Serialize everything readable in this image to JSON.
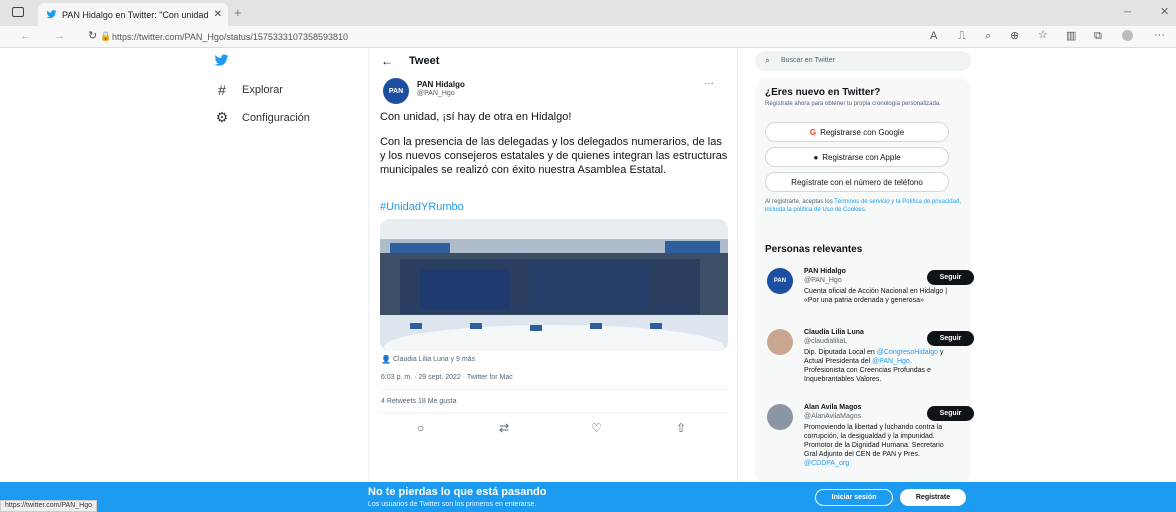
{
  "browser": {
    "tab_title": "PAN Hidalgo en Twitter: \"Con unidad, ¡sí hay de otra...\"",
    "url": "https://twitter.com/PAN_Hgo/status/1575333107358593810",
    "icons": [
      "tab-actions-icon",
      "twitter-bird-icon",
      "close-icon",
      "new-tab-icon",
      "back-icon",
      "forward-icon",
      "refresh-icon",
      "lock-icon",
      "read-aloud-icon",
      "immersive-reader-icon",
      "search-page-icon",
      "zoom-icon",
      "favorite-icon",
      "split-screen-icon",
      "collections-icon",
      "profile-icon",
      "more-icon",
      "minimize-icon",
      "close-window-icon"
    ]
  },
  "nav": {
    "items": [
      {
        "icon": "hashtag-icon",
        "label": "Explorar"
      },
      {
        "icon": "settings-icon",
        "label": "Configuración"
      }
    ]
  },
  "tweet_header": {
    "back": "←",
    "title": "Tweet"
  },
  "tweet": {
    "author_name": "PAN Hidalgo",
    "author_handle": "@PAN_Hgo",
    "avatar_text": "PAN",
    "more": "···",
    "text1": "Con unidad, ¡sí hay de otra en Hidalgo!",
    "text2": "Con la presencia de las delegadas y los delegados numerarios, de las y los nuevos consejeros estatales y de quienes integran las estructuras municipales se realizó con éxito nuestra Asamblea Estatal.",
    "hashtag": "#UnidadYRumbo",
    "photo_tag": "Claudia Lilia Luna y 9 más",
    "timestamp": "6:03 p. m. · 29 sept. 2022 · Twitter for Mac",
    "stats": "4 Retweets   18 Me gusta",
    "colors": {
      "accent": "#1d9bf0"
    }
  },
  "sidebar": {
    "search_placeholder": "Buscar en Twitter",
    "new_title": "¿Eres nuevo en Twitter?",
    "new_sub": "Regístrate ahora para obtener tu propia cronología personalizada.",
    "google_label": "Registrarse con Google",
    "apple_label": "Registrarse con Apple",
    "phone_label": "Regístrate con el número de teléfono",
    "terms_prefix": "Al registrarte, aceptas los ",
    "terms_link": "Términos de servicio y la Política de privacidad, incluida la política de Uso de Cookies.",
    "relevant_title": "Personas relevantes",
    "people": [
      {
        "name": "PAN Hidalgo",
        "handle": "@PAN_Hgo",
        "bio": "Cuenta oficial de Acción Nacional en Hidalgo | «Por una patria ordenada y generosa»",
        "follow": "Seguir"
      },
      {
        "name": "Claudia Lilia Luna",
        "handle": "@claudialiliaL",
        "bio_prefix": "Dip. Diputada Local en ",
        "bio_link1": "@CongresoHidalgo",
        "bio_mid": " y Actual Presidenta del ",
        "bio_link2": "@PAN_Hgo",
        "bio_suffix": ". Profesionista con Creencias Profundas e Inquebrantables Valores.",
        "follow": "Seguir"
      },
      {
        "name": "Alan Avila Magos",
        "handle": "@AlanAvilaMagos",
        "bio_prefix": "Promoviendo la libertad y luchando contra la corrupción, la desigualdad y la impunidad. Promotor de la Dignidad Humana. Secretario Gral Adjunto del CEN de PAN y Pres. ",
        "bio_link1": "@CDDPA_org",
        "follow": "Seguir"
      }
    ]
  },
  "banner": {
    "title": "No te pierdas lo que está pasando",
    "subtitle": "Los usuarios de Twitter son los primeros en enterarse.",
    "login": "Iniciar sesión",
    "signup": "Regístrate"
  },
  "status_bar": "https://twitter.com/PAN_Hgo"
}
